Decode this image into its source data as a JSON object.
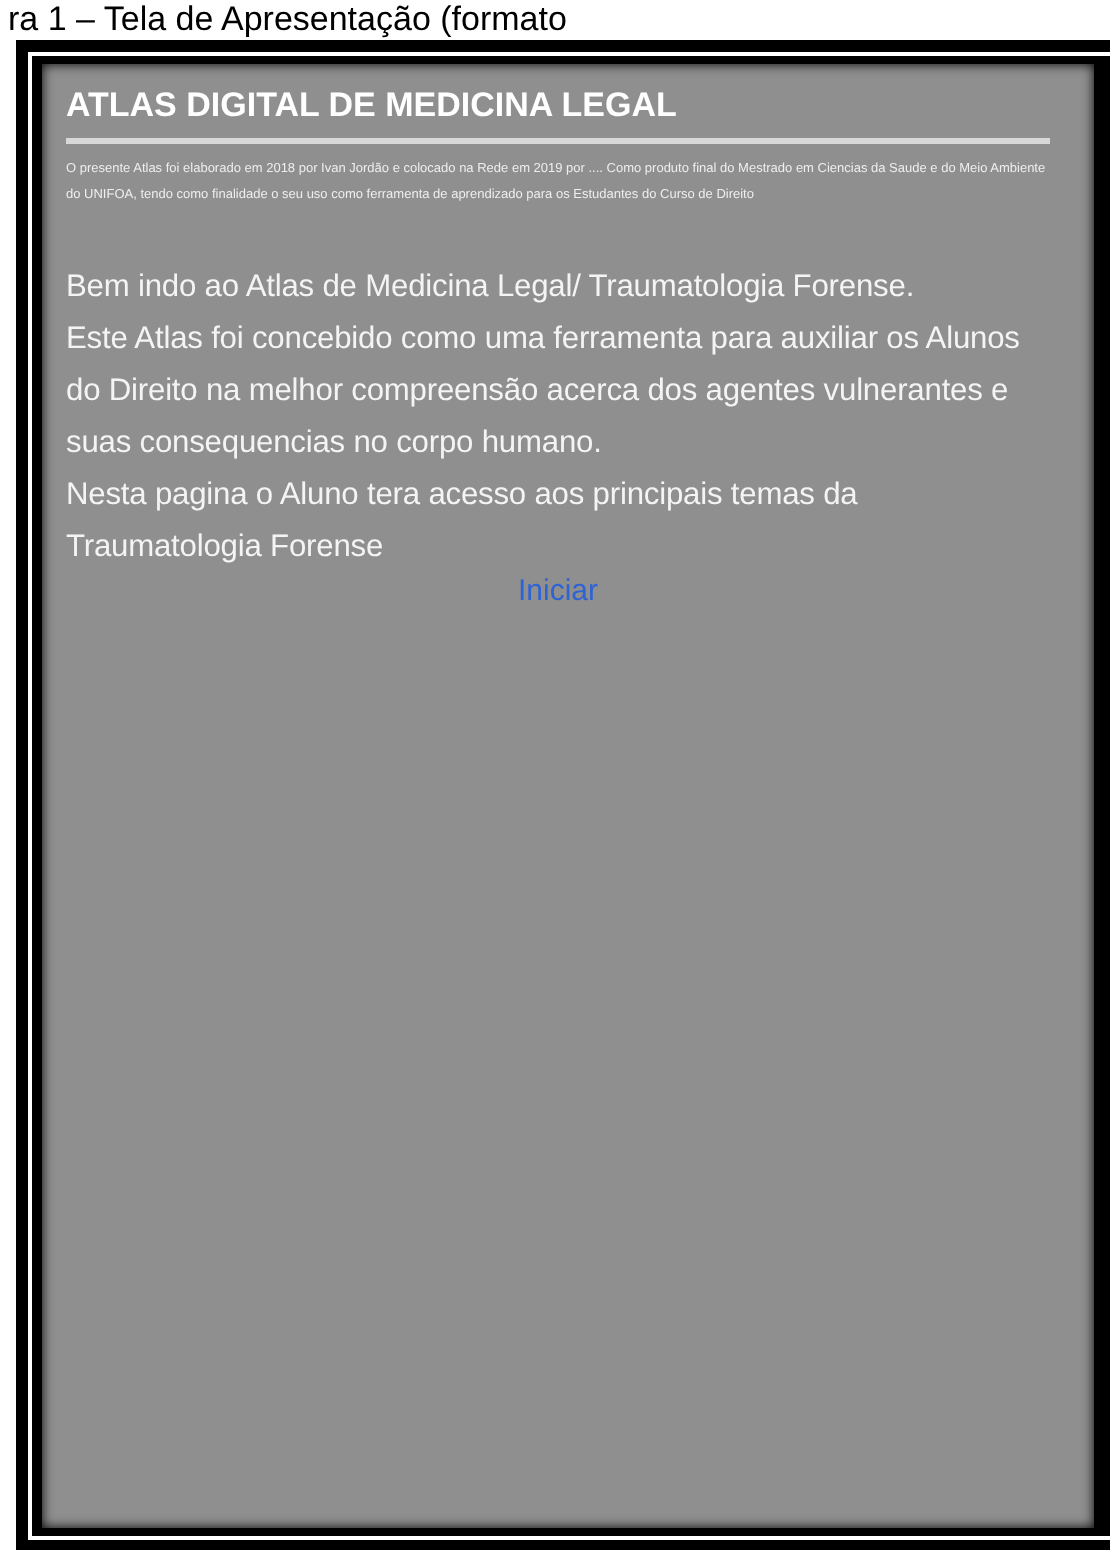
{
  "caption": "ra 1 – Tela de Apresentação (formato",
  "screen": {
    "title": "ATLAS DIGITAL DE MEDICINA LEGAL",
    "intro": "O presente Atlas foi elaborado em 2018 por Ivan Jordão e colocado na Rede em 2019 por .... Como produto final do Mestrado em Ciencias da Saude e do Meio Ambiente do UNIFOA, tendo como finalidade o seu uso como ferramenta de aprendizado para os Estudantes do Curso de Direito",
    "paragraphs": [
      "Bem indo ao Atlas de Medicina Legal/ Traumatologia Forense.",
      "Este Atlas foi concebido como uma ferramenta para auxiliar os Alunos do Direito na melhor compreensão acerca dos agentes vulnerantes e suas consequencias no corpo humano.",
      "Nesta pagina o Aluno tera acesso aos principais temas da Traumatologia Forense"
    ],
    "link": "Iniciar"
  }
}
